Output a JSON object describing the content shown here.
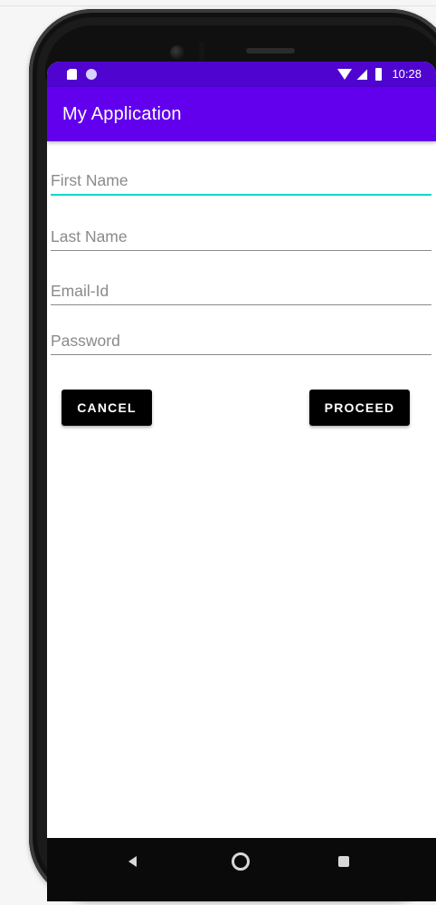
{
  "status_bar": {
    "time": "10:28",
    "left_icons": [
      "sd-card-icon",
      "circle-icon"
    ],
    "right_icons": [
      "wifi-icon",
      "signal-icon",
      "battery-icon"
    ]
  },
  "app_bar": {
    "title": "My Application"
  },
  "form": {
    "first_name": {
      "placeholder": "First Name",
      "value": ""
    },
    "last_name": {
      "placeholder": "Last Name",
      "value": ""
    },
    "email": {
      "placeholder": "Email-Id",
      "value": ""
    },
    "password": {
      "placeholder": "Password",
      "value": ""
    }
  },
  "buttons": {
    "cancel": "CANCEL",
    "proceed": "PROCEED"
  },
  "nav_bar": {
    "icons": [
      "back-icon",
      "home-icon",
      "recent-apps-icon"
    ]
  },
  "colors": {
    "status_bar": "#4f04d0",
    "app_bar": "#6200ee",
    "focus_underline": "#03dac5",
    "button_bg": "#000000"
  }
}
